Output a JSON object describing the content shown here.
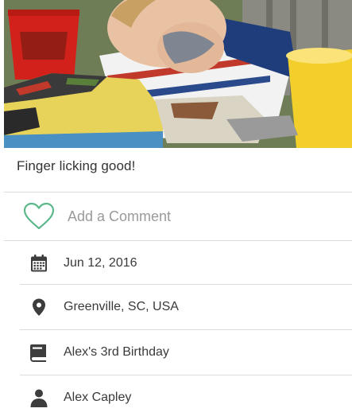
{
  "photo": {
    "description_icon": "photo-birthday-cake"
  },
  "caption": "Finger licking good!",
  "comment": {
    "label": "Add a Comment",
    "icon": "heart-outline-icon",
    "accent": "#5cb88a"
  },
  "details": {
    "date": {
      "label": "Jun 12, 2016",
      "icon": "calendar-icon"
    },
    "location": {
      "label": "Greenville, SC, USA",
      "icon": "location-pin-icon"
    },
    "album": {
      "label": "Alex's 3rd Birthday",
      "icon": "book-icon"
    },
    "person": {
      "label": "Alex Capley",
      "icon": "person-icon"
    }
  },
  "colors": {
    "icon": "#3d3d3d",
    "divider": "#dcdcdc",
    "muted_text": "#9a9a9a"
  }
}
